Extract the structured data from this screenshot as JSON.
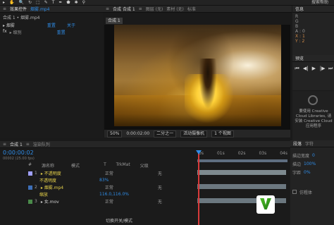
{
  "toolbar": {
    "tools": [
      "▸",
      "✋",
      "🔍",
      "↻",
      "⬚",
      "✎",
      "T",
      "✒",
      "⬟",
      "✱",
      "⚲"
    ],
    "right_label": "搜索帮助"
  },
  "project_panel": {
    "tabs": [
      "≡",
      "效果控件",
      "烟雾.mp4",
      "≡"
    ],
    "title": "合成 1 • 烟雾.mp4",
    "col_layer": "▸ 烟雾",
    "col_mode": "重置",
    "col_about": "关于",
    "row_fx": "fx",
    "row_label": "▸ 级别",
    "row_reset": "重置"
  },
  "comp_panel": {
    "tabs": [
      "≡",
      "合成 合成 1",
      "≡",
      "图层 (无)",
      "素材 (无)",
      "标准"
    ],
    "breadcrumb": "合成 1"
  },
  "viewer_controls": {
    "zoom": "50%",
    "time": "0:00:02:00",
    "quality": "二分之一",
    "camera": "活动摄像机",
    "views": "1 个视图"
  },
  "right_panel": {
    "info_tab": "信息",
    "info_lines": [
      "R",
      "G",
      "B",
      "A : 0"
    ],
    "x_label": "X : 1",
    "y_label": "Y : 2",
    "preview_tab": "预览",
    "preview_controls": [
      "⏮",
      "◀|",
      "▶",
      "|▶",
      "⏭"
    ],
    "cc_text": "要使用 Creative Cloud Libraries, 请安装 Creative Cloud 应用程序",
    "paragraph_tab": "段落",
    "character_tab": "字符",
    "para_rows": [
      "描边宽度",
      "描边",
      "字距"
    ],
    "para_values": [
      "0",
      "100%",
      "0%"
    ],
    "para_check": "仿粗体"
  },
  "timeline": {
    "tabs": [
      "≡",
      "合成 1",
      "≡",
      "渲染队列"
    ],
    "timecode": "0:00:00:02",
    "fps": "00002 (25.00 fps)",
    "header_cols": [
      "#",
      "源名称",
      "模式",
      "T",
      "TrkMat",
      "父级"
    ],
    "layers": [
      {
        "num": "1",
        "name": "▸ 不透明度",
        "mode": "正常",
        "parent": "无",
        "color": "#a0a0ff"
      },
      {
        "num": "",
        "name": "不透明度",
        "mode": "",
        "parent": "",
        "color": "#d6c24a"
      },
      {
        "num": "2",
        "name": "▸ 烟雾.mp4",
        "mode": "正常",
        "parent": "无",
        "color": "#3d6fb8"
      },
      {
        "num": "",
        "name": "缩放",
        "mode": "",
        "parent": "",
        "color": "#d6c24a"
      },
      {
        "num": "3",
        "name": "▸ 女.mov",
        "mode": "正常",
        "parent": "无",
        "color": "#4a8a4a"
      }
    ],
    "layer_values": [
      "83%",
      "116.0,116.0%"
    ],
    "ruler": [
      "0s",
      "01s",
      "02s",
      "03s",
      "04s"
    ],
    "bottom_label": "切换开关/模式"
  },
  "colors": {
    "accent_blue": "#2f8ce6",
    "cti_red": "#d83a3a"
  }
}
